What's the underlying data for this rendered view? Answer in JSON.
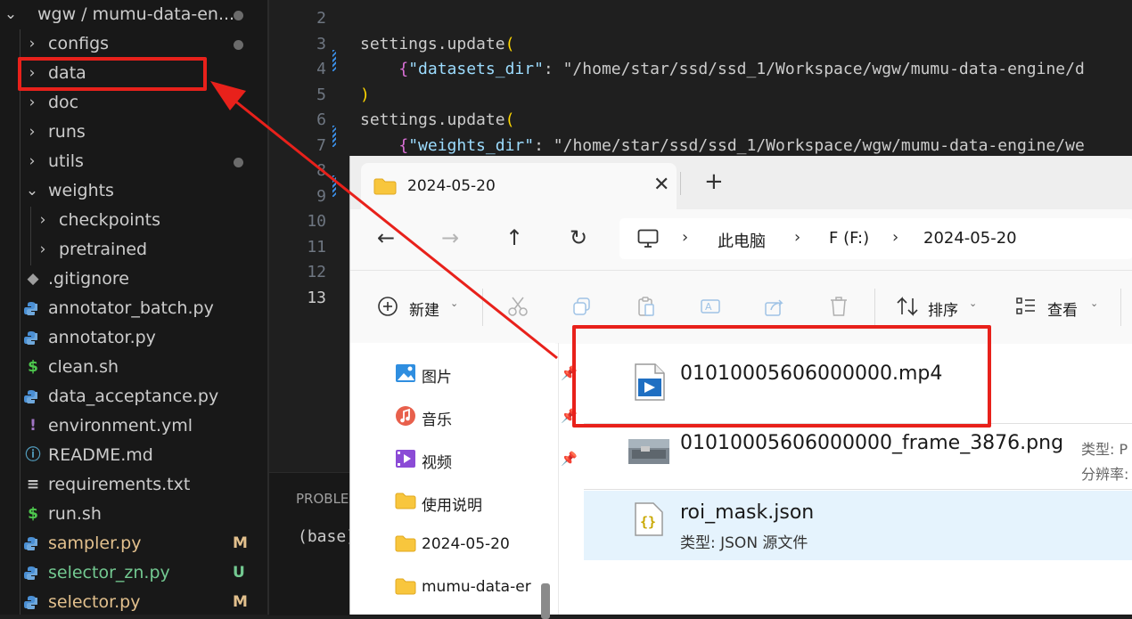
{
  "explorer": {
    "root_label": "wgw / mumu-data-en...",
    "items": [
      {
        "label": "configs",
        "kind": "folder",
        "badge": "",
        "dot": true
      },
      {
        "label": "data",
        "kind": "folder",
        "badge": "",
        "dot": false
      },
      {
        "label": "doc",
        "kind": "folder",
        "badge": "",
        "dot": false
      },
      {
        "label": "runs",
        "kind": "folder",
        "badge": "",
        "dot": false
      },
      {
        "label": "utils",
        "kind": "folder",
        "badge": "",
        "dot": true
      },
      {
        "label": "weights",
        "kind": "folder-open",
        "badge": "",
        "dot": false
      },
      {
        "label": "checkpoints",
        "kind": "subfolder",
        "badge": "",
        "dot": false
      },
      {
        "label": "pretrained",
        "kind": "subfolder",
        "badge": "",
        "dot": false
      },
      {
        "label": ".gitignore",
        "kind": "git",
        "badge": "",
        "dot": false
      },
      {
        "label": "annotator_batch.py",
        "kind": "py",
        "badge": "",
        "dot": false
      },
      {
        "label": "annotator.py",
        "kind": "py",
        "badge": "",
        "dot": false
      },
      {
        "label": "clean.sh",
        "kind": "sh",
        "badge": "",
        "dot": false
      },
      {
        "label": "data_acceptance.py",
        "kind": "py",
        "badge": "",
        "dot": false
      },
      {
        "label": "environment.yml",
        "kind": "yml",
        "badge": "",
        "dot": false
      },
      {
        "label": "README.md",
        "kind": "md",
        "badge": "",
        "dot": false
      },
      {
        "label": "requirements.txt",
        "kind": "txt",
        "badge": "",
        "dot": false
      },
      {
        "label": "run.sh",
        "kind": "sh",
        "badge": "",
        "dot": false
      },
      {
        "label": "sampler.py",
        "kind": "py",
        "badge": "M",
        "dot": false
      },
      {
        "label": "selector_zn.py",
        "kind": "py",
        "badge": "U",
        "dot": false
      },
      {
        "label": "selector.py",
        "kind": "py",
        "badge": "M",
        "dot": false
      }
    ]
  },
  "editor": {
    "lines": [
      {
        "num": "2",
        "text": ""
      },
      {
        "num": "3",
        "text": "settings.update("
      },
      {
        "num": "4",
        "text": "    {\"datasets_dir\": \"/home/star/ssd/ssd_1/Workspace/wgw/mumu-data-engine/d"
      },
      {
        "num": "5",
        "text": ")"
      },
      {
        "num": "6",
        "text": "settings.update("
      },
      {
        "num": "7",
        "text": "    {\"weights_dir\": \"/home/star/ssd/ssd_1/Workspace/wgw/mumu-data-engine/we"
      },
      {
        "num": "8",
        "text": ""
      },
      {
        "num": "9",
        "text": ""
      },
      {
        "num": "10",
        "text": ""
      },
      {
        "num": "11",
        "text": ""
      },
      {
        "num": "12",
        "text": ""
      },
      {
        "num": "13",
        "text": ""
      }
    ],
    "panel_tab": "PROBLE",
    "terminal_text": "(base)"
  },
  "file_explorer": {
    "tab_title": "2024-05-20",
    "breadcrumb": [
      "此电脑",
      "F (F:)",
      "2024-05-20"
    ],
    "toolbar": {
      "new_label": "新建",
      "sort_label": "排序",
      "view_label": "查看"
    },
    "nav_items": [
      {
        "label": "图片",
        "pinned": true
      },
      {
        "label": "音乐",
        "pinned": true
      },
      {
        "label": "视频",
        "pinned": true
      },
      {
        "label": "使用说明",
        "pinned": false
      },
      {
        "label": "2024-05-20",
        "pinned": false
      },
      {
        "label": "mumu-data-er",
        "pinned": false
      }
    ],
    "files": [
      {
        "name": "01010005606000000.mp4",
        "meta": "",
        "side1": "",
        "side2": ""
      },
      {
        "name": "01010005606000000_frame_3876.png",
        "meta": "",
        "side1": "类型: P",
        "side2": "分辨率:"
      },
      {
        "name": "roi_mask.json",
        "meta": "类型: JSON 源文件",
        "side1": "",
        "side2": ""
      }
    ]
  },
  "colors": {
    "annotation_red": "#e8211b",
    "selection_blue": "#e5f3fd",
    "git_modified": "#e2c08d",
    "git_untracked": "#73c991"
  }
}
